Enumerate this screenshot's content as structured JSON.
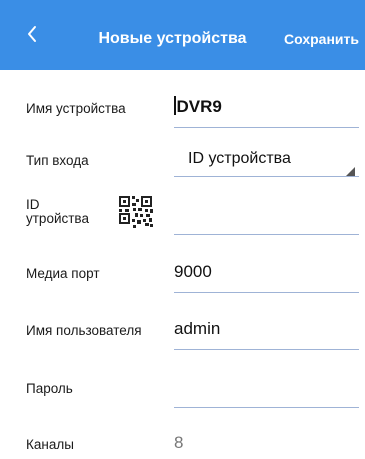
{
  "header": {
    "back_icon": "chevron-left-icon",
    "title": "Новые устройства",
    "save_label": "Сохранить",
    "color": "#3a8ee6"
  },
  "form": {
    "device_name": {
      "label": "Имя устройства",
      "value": "DVR9"
    },
    "login_type": {
      "label": "Тип входа",
      "value": "ID устройства"
    },
    "device_id": {
      "label_line1": "ID",
      "label_line2": "утройства",
      "value": "",
      "qr_icon": "qr-code-icon"
    },
    "media_port": {
      "label": "Медиа порт",
      "value": "9000"
    },
    "username": {
      "label": "Имя пользователя",
      "value": "admin"
    },
    "password": {
      "label": "Пароль",
      "value": ""
    },
    "channels": {
      "label": "Каналы",
      "value": "8"
    }
  }
}
